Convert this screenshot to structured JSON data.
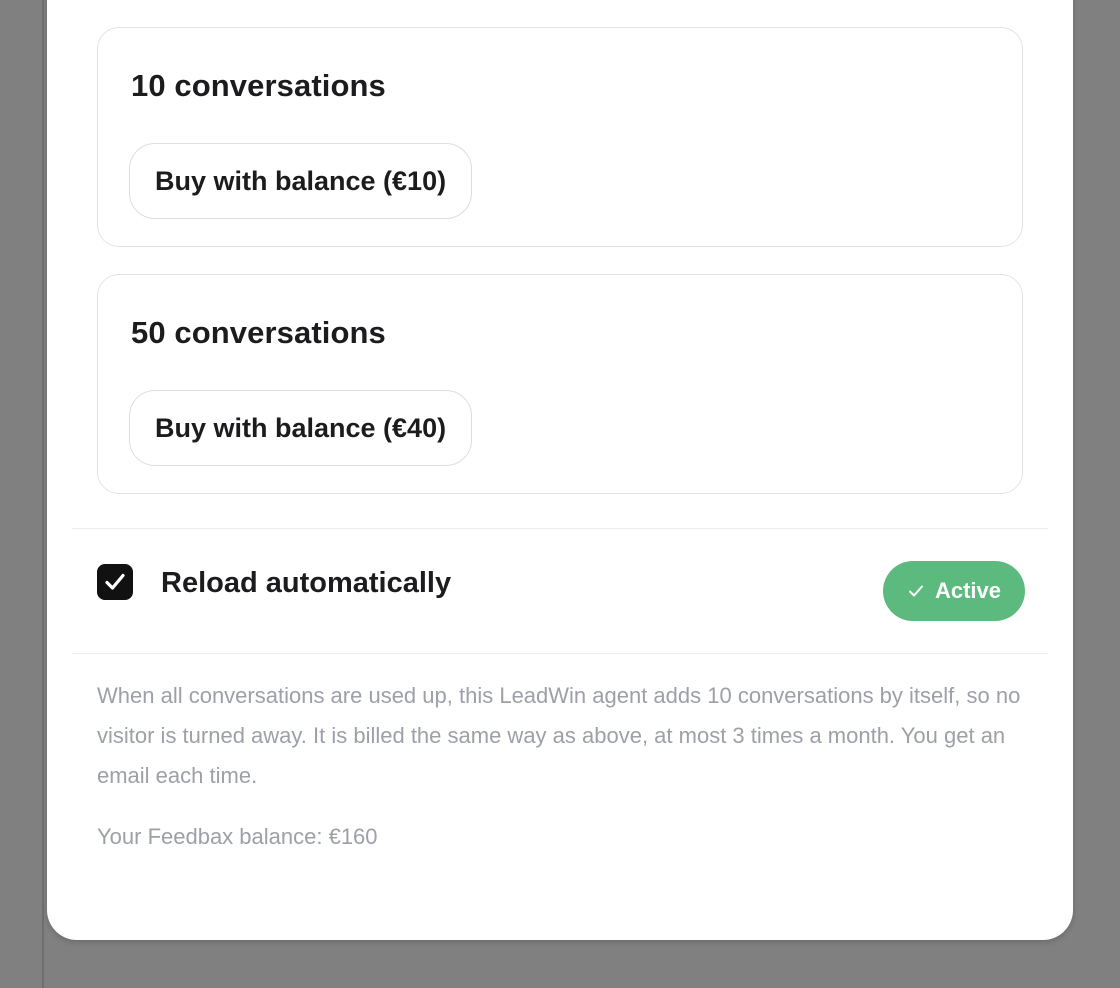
{
  "packages": [
    {
      "title": "10 conversations",
      "button_label": "Buy with balance (€10)"
    },
    {
      "title": "50 conversations",
      "button_label": "Buy with balance (€40)"
    }
  ],
  "auto_reload": {
    "label": "Reload automatically",
    "checked": true,
    "status_label": "Active",
    "status_color": "#5cba7e",
    "description": "When all conversations are used up, this LeadWin agent adds 10 conversations by itself, so no visitor is turned away. It is billed the same way as above, at most 3 times a month. You get an email each time."
  },
  "balance_text": "Your Feedbax balance: €160",
  "icons": {
    "checkbox": "check-icon",
    "status": "checkmark-icon"
  }
}
